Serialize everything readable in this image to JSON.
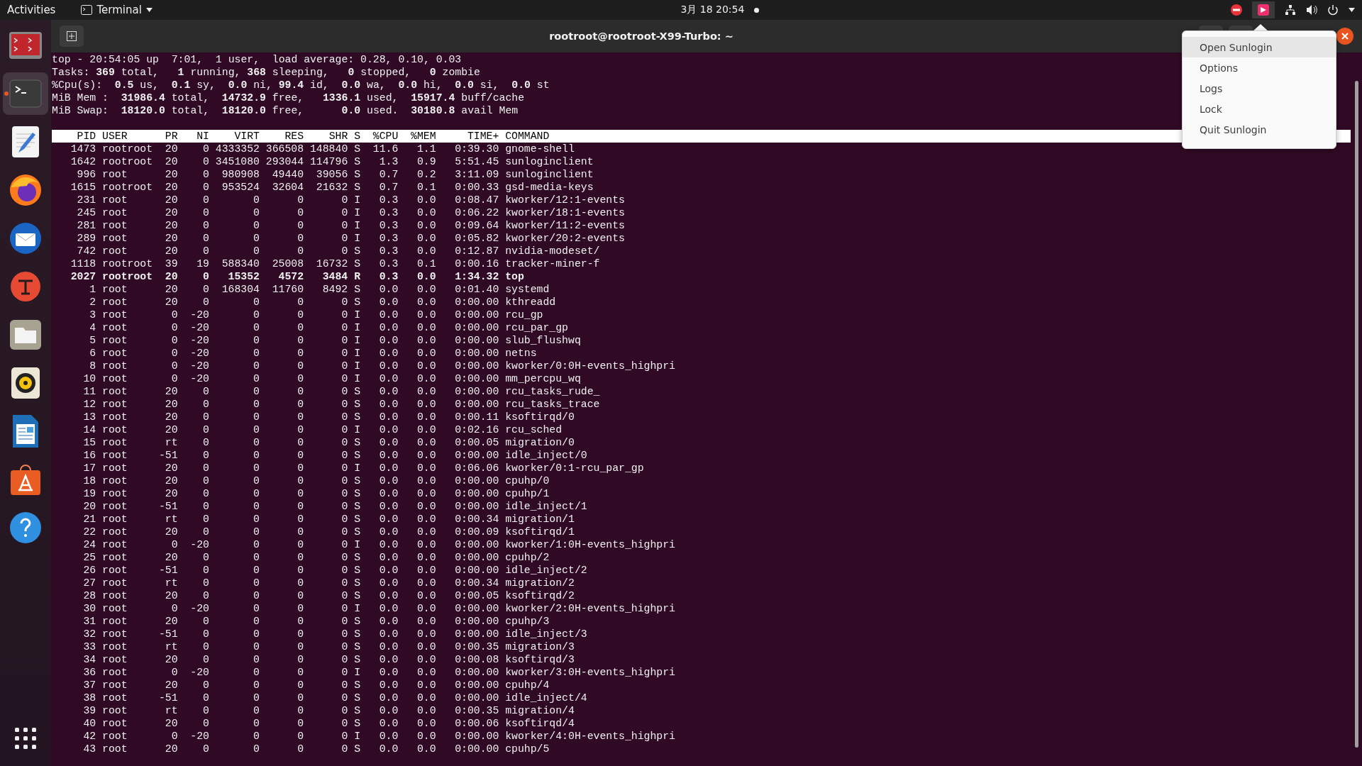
{
  "top_bar": {
    "activities": "Activities",
    "app_menu": "Terminal",
    "clock": "3月 18  20:54"
  },
  "dock": [
    {
      "kind": "monitor",
      "running": false
    },
    {
      "kind": "terminal",
      "running": true
    },
    {
      "kind": "editor",
      "running": false
    },
    {
      "kind": "browser",
      "running": false
    },
    {
      "kind": "mail",
      "running": false
    },
    {
      "kind": "letter",
      "running": false
    },
    {
      "kind": "folder",
      "running": false
    },
    {
      "kind": "speaker",
      "running": false
    },
    {
      "kind": "document",
      "running": false
    },
    {
      "kind": "store",
      "running": false
    },
    {
      "kind": "help",
      "running": false
    }
  ],
  "window": {
    "title": "rootroot@rootroot-X99-Turbo: ~"
  },
  "summary": [
    "top - 20:54:05 up  7:01,  1 user,  load average: 0.28, 0.10, 0.03",
    "Tasks: **369** total,   **1** running, **368** sleeping,   **0** stopped,   **0** zombie",
    "%Cpu(s):  **0.5** us,  **0.1** sy,  **0.0** ni, **99.4** id,  **0.0** wa,  **0.0** hi,  **0.0** si,  **0.0** st",
    "MiB Mem :  **31986.4** total,  **14732.9** free,   **1336.1** used,  **15917.4** buff/cache",
    "MiB Swap:  **18120.0** total,  **18120.0** free,      **0.0** used.  **30180.8** avail Mem"
  ],
  "table": {
    "columns": [
      "PID",
      "USER",
      "PR",
      "NI",
      "VIRT",
      "RES",
      "SHR",
      "S",
      "%CPU",
      "%MEM",
      "TIME+",
      "COMMAND"
    ],
    "rows": [
      {
        "bold": false,
        "cells": [
          "1473",
          "rootroot",
          "20",
          "0",
          "4333352",
          "366508",
          "148840",
          "S",
          "11.6",
          "1.1",
          "0:39.30",
          "gnome-shell"
        ]
      },
      {
        "bold": false,
        "cells": [
          "1642",
          "rootroot",
          "20",
          "0",
          "3451080",
          "293044",
          "114796",
          "S",
          "1.3",
          "0.9",
          "5:51.45",
          "sunloginclient"
        ]
      },
      {
        "bold": false,
        "cells": [
          "996",
          "root",
          "20",
          "0",
          "980908",
          "49440",
          "39056",
          "S",
          "0.7",
          "0.2",
          "3:11.09",
          "sunloginclient"
        ]
      },
      {
        "bold": false,
        "cells": [
          "1615",
          "rootroot",
          "20",
          "0",
          "953524",
          "32604",
          "21632",
          "S",
          "0.7",
          "0.1",
          "0:00.33",
          "gsd-media-keys"
        ]
      },
      {
        "bold": false,
        "cells": [
          "231",
          "root",
          "20",
          "0",
          "0",
          "0",
          "0",
          "I",
          "0.3",
          "0.0",
          "0:08.47",
          "kworker/12:1-events"
        ]
      },
      {
        "bold": false,
        "cells": [
          "245",
          "root",
          "20",
          "0",
          "0",
          "0",
          "0",
          "I",
          "0.3",
          "0.0",
          "0:06.22",
          "kworker/18:1-events"
        ]
      },
      {
        "bold": false,
        "cells": [
          "281",
          "root",
          "20",
          "0",
          "0",
          "0",
          "0",
          "I",
          "0.3",
          "0.0",
          "0:09.64",
          "kworker/11:2-events"
        ]
      },
      {
        "bold": false,
        "cells": [
          "289",
          "root",
          "20",
          "0",
          "0",
          "0",
          "0",
          "I",
          "0.3",
          "0.0",
          "0:05.82",
          "kworker/20:2-events"
        ]
      },
      {
        "bold": false,
        "cells": [
          "742",
          "root",
          "20",
          "0",
          "0",
          "0",
          "0",
          "S",
          "0.3",
          "0.0",
          "0:12.87",
          "nvidia-modeset/"
        ]
      },
      {
        "bold": false,
        "cells": [
          "1118",
          "rootroot",
          "39",
          "19",
          "588340",
          "25008",
          "16732",
          "S",
          "0.3",
          "0.1",
          "0:00.16",
          "tracker-miner-f"
        ]
      },
      {
        "bold": true,
        "cells": [
          "2027",
          "rootroot",
          "20",
          "0",
          "15352",
          "4572",
          "3484",
          "R",
          "0.3",
          "0.0",
          "1:34.32",
          "top"
        ]
      },
      {
        "bold": false,
        "cells": [
          "1",
          "root",
          "20",
          "0",
          "168304",
          "11760",
          "8492",
          "S",
          "0.0",
          "0.0",
          "0:01.40",
          "systemd"
        ]
      },
      {
        "bold": false,
        "cells": [
          "2",
          "root",
          "20",
          "0",
          "0",
          "0",
          "0",
          "S",
          "0.0",
          "0.0",
          "0:00.00",
          "kthreadd"
        ]
      },
      {
        "bold": false,
        "cells": [
          "3",
          "root",
          "0",
          "-20",
          "0",
          "0",
          "0",
          "I",
          "0.0",
          "0.0",
          "0:00.00",
          "rcu_gp"
        ]
      },
      {
        "bold": false,
        "cells": [
          "4",
          "root",
          "0",
          "-20",
          "0",
          "0",
          "0",
          "I",
          "0.0",
          "0.0",
          "0:00.00",
          "rcu_par_gp"
        ]
      },
      {
        "bold": false,
        "cells": [
          "5",
          "root",
          "0",
          "-20",
          "0",
          "0",
          "0",
          "I",
          "0.0",
          "0.0",
          "0:00.00",
          "slub_flushwq"
        ]
      },
      {
        "bold": false,
        "cells": [
          "6",
          "root",
          "0",
          "-20",
          "0",
          "0",
          "0",
          "I",
          "0.0",
          "0.0",
          "0:00.00",
          "netns"
        ]
      },
      {
        "bold": false,
        "cells": [
          "8",
          "root",
          "0",
          "-20",
          "0",
          "0",
          "0",
          "I",
          "0.0",
          "0.0",
          "0:00.00",
          "kworker/0:0H-events_highpri"
        ]
      },
      {
        "bold": false,
        "cells": [
          "10",
          "root",
          "0",
          "-20",
          "0",
          "0",
          "0",
          "I",
          "0.0",
          "0.0",
          "0:00.00",
          "mm_percpu_wq"
        ]
      },
      {
        "bold": false,
        "cells": [
          "11",
          "root",
          "20",
          "0",
          "0",
          "0",
          "0",
          "S",
          "0.0",
          "0.0",
          "0:00.00",
          "rcu_tasks_rude_"
        ]
      },
      {
        "bold": false,
        "cells": [
          "12",
          "root",
          "20",
          "0",
          "0",
          "0",
          "0",
          "S",
          "0.0",
          "0.0",
          "0:00.00",
          "rcu_tasks_trace"
        ]
      },
      {
        "bold": false,
        "cells": [
          "13",
          "root",
          "20",
          "0",
          "0",
          "0",
          "0",
          "S",
          "0.0",
          "0.0",
          "0:00.11",
          "ksoftirqd/0"
        ]
      },
      {
        "bold": false,
        "cells": [
          "14",
          "root",
          "20",
          "0",
          "0",
          "0",
          "0",
          "I",
          "0.0",
          "0.0",
          "0:02.16",
          "rcu_sched"
        ]
      },
      {
        "bold": false,
        "cells": [
          "15",
          "root",
          "rt",
          "0",
          "0",
          "0",
          "0",
          "S",
          "0.0",
          "0.0",
          "0:00.05",
          "migration/0"
        ]
      },
      {
        "bold": false,
        "cells": [
          "16",
          "root",
          "-51",
          "0",
          "0",
          "0",
          "0",
          "S",
          "0.0",
          "0.0",
          "0:00.00",
          "idle_inject/0"
        ]
      },
      {
        "bold": false,
        "cells": [
          "17",
          "root",
          "20",
          "0",
          "0",
          "0",
          "0",
          "I",
          "0.0",
          "0.0",
          "0:06.06",
          "kworker/0:1-rcu_par_gp"
        ]
      },
      {
        "bold": false,
        "cells": [
          "18",
          "root",
          "20",
          "0",
          "0",
          "0",
          "0",
          "S",
          "0.0",
          "0.0",
          "0:00.00",
          "cpuhp/0"
        ]
      },
      {
        "bold": false,
        "cells": [
          "19",
          "root",
          "20",
          "0",
          "0",
          "0",
          "0",
          "S",
          "0.0",
          "0.0",
          "0:00.00",
          "cpuhp/1"
        ]
      },
      {
        "bold": false,
        "cells": [
          "20",
          "root",
          "-51",
          "0",
          "0",
          "0",
          "0",
          "S",
          "0.0",
          "0.0",
          "0:00.00",
          "idle_inject/1"
        ]
      },
      {
        "bold": false,
        "cells": [
          "21",
          "root",
          "rt",
          "0",
          "0",
          "0",
          "0",
          "S",
          "0.0",
          "0.0",
          "0:00.34",
          "migration/1"
        ]
      },
      {
        "bold": false,
        "cells": [
          "22",
          "root",
          "20",
          "0",
          "0",
          "0",
          "0",
          "S",
          "0.0",
          "0.0",
          "0:00.09",
          "ksoftirqd/1"
        ]
      },
      {
        "bold": false,
        "cells": [
          "24",
          "root",
          "0",
          "-20",
          "0",
          "0",
          "0",
          "I",
          "0.0",
          "0.0",
          "0:00.00",
          "kworker/1:0H-events_highpri"
        ]
      },
      {
        "bold": false,
        "cells": [
          "25",
          "root",
          "20",
          "0",
          "0",
          "0",
          "0",
          "S",
          "0.0",
          "0.0",
          "0:00.00",
          "cpuhp/2"
        ]
      },
      {
        "bold": false,
        "cells": [
          "26",
          "root",
          "-51",
          "0",
          "0",
          "0",
          "0",
          "S",
          "0.0",
          "0.0",
          "0:00.00",
          "idle_inject/2"
        ]
      },
      {
        "bold": false,
        "cells": [
          "27",
          "root",
          "rt",
          "0",
          "0",
          "0",
          "0",
          "S",
          "0.0",
          "0.0",
          "0:00.34",
          "migration/2"
        ]
      },
      {
        "bold": false,
        "cells": [
          "28",
          "root",
          "20",
          "0",
          "0",
          "0",
          "0",
          "S",
          "0.0",
          "0.0",
          "0:00.05",
          "ksoftirqd/2"
        ]
      },
      {
        "bold": false,
        "cells": [
          "30",
          "root",
          "0",
          "-20",
          "0",
          "0",
          "0",
          "I",
          "0.0",
          "0.0",
          "0:00.00",
          "kworker/2:0H-events_highpri"
        ]
      },
      {
        "bold": false,
        "cells": [
          "31",
          "root",
          "20",
          "0",
          "0",
          "0",
          "0",
          "S",
          "0.0",
          "0.0",
          "0:00.00",
          "cpuhp/3"
        ]
      },
      {
        "bold": false,
        "cells": [
          "32",
          "root",
          "-51",
          "0",
          "0",
          "0",
          "0",
          "S",
          "0.0",
          "0.0",
          "0:00.00",
          "idle_inject/3"
        ]
      },
      {
        "bold": false,
        "cells": [
          "33",
          "root",
          "rt",
          "0",
          "0",
          "0",
          "0",
          "S",
          "0.0",
          "0.0",
          "0:00.35",
          "migration/3"
        ]
      },
      {
        "bold": false,
        "cells": [
          "34",
          "root",
          "20",
          "0",
          "0",
          "0",
          "0",
          "S",
          "0.0",
          "0.0",
          "0:00.08",
          "ksoftirqd/3"
        ]
      },
      {
        "bold": false,
        "cells": [
          "36",
          "root",
          "0",
          "-20",
          "0",
          "0",
          "0",
          "I",
          "0.0",
          "0.0",
          "0:00.00",
          "kworker/3:0H-events_highpri"
        ]
      },
      {
        "bold": false,
        "cells": [
          "37",
          "root",
          "20",
          "0",
          "0",
          "0",
          "0",
          "S",
          "0.0",
          "0.0",
          "0:00.00",
          "cpuhp/4"
        ]
      },
      {
        "bold": false,
        "cells": [
          "38",
          "root",
          "-51",
          "0",
          "0",
          "0",
          "0",
          "S",
          "0.0",
          "0.0",
          "0:00.00",
          "idle_inject/4"
        ]
      },
      {
        "bold": false,
        "cells": [
          "39",
          "root",
          "rt",
          "0",
          "0",
          "0",
          "0",
          "S",
          "0.0",
          "0.0",
          "0:00.35",
          "migration/4"
        ]
      },
      {
        "bold": false,
        "cells": [
          "40",
          "root",
          "20",
          "0",
          "0",
          "0",
          "0",
          "S",
          "0.0",
          "0.0",
          "0:00.06",
          "ksoftirqd/4"
        ]
      },
      {
        "bold": false,
        "cells": [
          "42",
          "root",
          "0",
          "-20",
          "0",
          "0",
          "0",
          "I",
          "0.0",
          "0.0",
          "0:00.00",
          "kworker/4:0H-events_highpri"
        ]
      },
      {
        "bold": false,
        "cells": [
          "43",
          "root",
          "20",
          "0",
          "0",
          "0",
          "0",
          "S",
          "0.0",
          "0.0",
          "0:00.00",
          "cpuhp/5"
        ]
      }
    ]
  },
  "menu": [
    {
      "label": "Open Sunlogin",
      "selected": true
    },
    {
      "label": "Options",
      "selected": false
    },
    {
      "label": "Logs",
      "selected": false
    },
    {
      "label": "Lock",
      "selected": false
    },
    {
      "label": "Quit Sunlogin",
      "selected": false
    }
  ]
}
